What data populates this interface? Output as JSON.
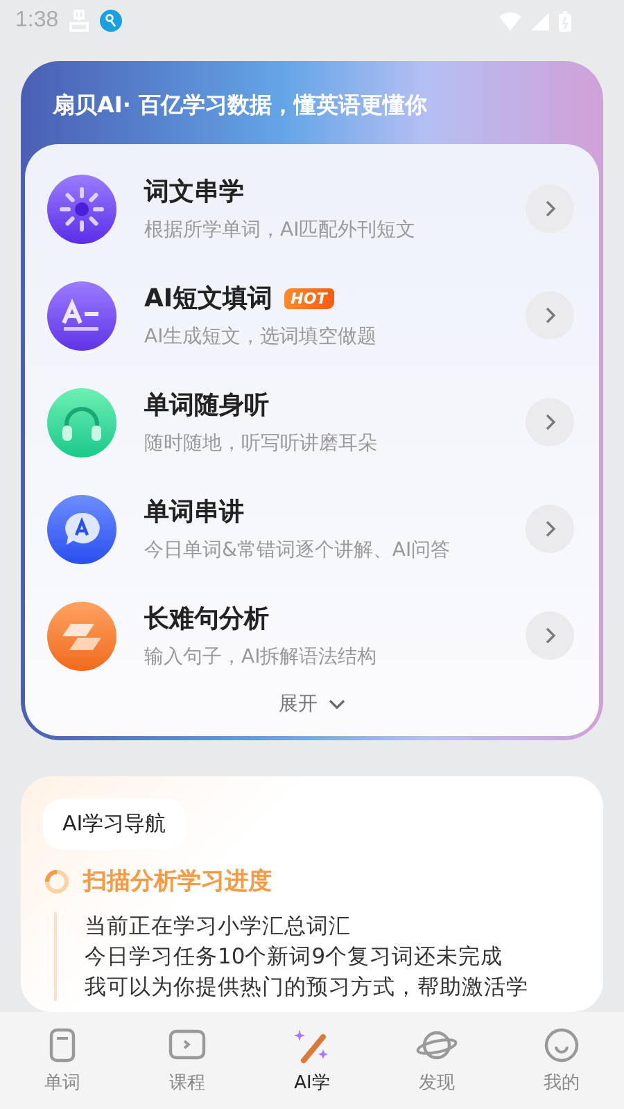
{
  "status_bar": {
    "time": "1:38"
  },
  "banner": {
    "title": "扇贝AI· 百亿学习数据，懂英语更懂你"
  },
  "features": [
    {
      "kind": "spark",
      "title": "词文串学",
      "subtitle": "根据所学单词，AI匹配外刊短文"
    },
    {
      "kind": "text",
      "title": "AI短文填词",
      "badge": "HOT",
      "subtitle": "AI生成短文，选词填空做题"
    },
    {
      "kind": "headphones",
      "title": "单词随身听",
      "subtitle": "随时随地，听写听讲磨耳朵"
    },
    {
      "kind": "chat",
      "title": "单词串讲",
      "subtitle": "今日单词&常错词逐个讲解、AI问答"
    },
    {
      "kind": "layers",
      "title": "长难句分析",
      "subtitle": "输入句子，AI拆解语法结构"
    }
  ],
  "expand": {
    "label": "展开"
  },
  "guide": {
    "tag": "AI学习导航",
    "step": "扫描分析学习进度",
    "lines": [
      "当前正在学习小学汇总词汇",
      "今日学习任务10个新词9个复习词还未完成",
      "我可以为你提供热门的预习方式，帮助激活学"
    ]
  },
  "tabs": [
    {
      "kind": "word",
      "label": "单词",
      "selected": false
    },
    {
      "kind": "course",
      "label": "课程",
      "selected": false
    },
    {
      "kind": "ai",
      "label": "AI学",
      "selected": true
    },
    {
      "kind": "discover",
      "label": "发现",
      "selected": false
    },
    {
      "kind": "me",
      "label": "我的",
      "selected": false
    }
  ]
}
